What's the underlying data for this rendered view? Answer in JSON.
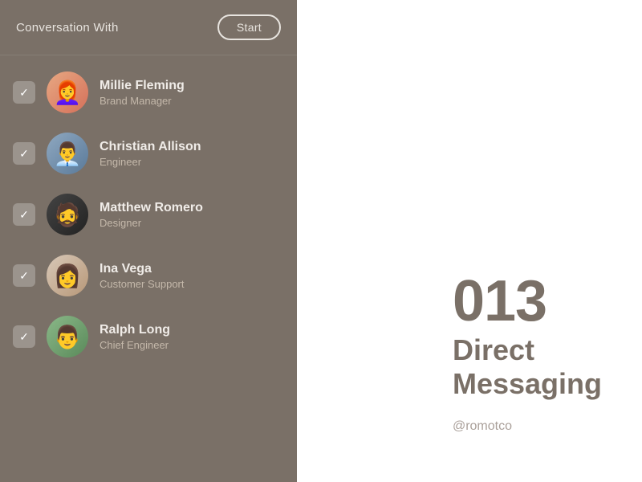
{
  "header": {
    "title": "Conversation With",
    "start_button": "Start"
  },
  "contacts": [
    {
      "id": "millie",
      "name": "Millie Fleming",
      "role": "Brand Manager",
      "checked": true,
      "emoji": "👩"
    },
    {
      "id": "christian",
      "name": "Christian Allison",
      "role": "Engineer",
      "checked": true,
      "emoji": "👨"
    },
    {
      "id": "matthew",
      "name": "Matthew Romero",
      "role": "Designer",
      "checked": true,
      "emoji": "🧔"
    },
    {
      "id": "ina",
      "name": "Ina Vega",
      "role": "Customer Support",
      "checked": true,
      "emoji": "👩"
    },
    {
      "id": "ralph",
      "name": "Ralph Long",
      "role": "Chief Engineer",
      "checked": true,
      "emoji": "👨"
    }
  ],
  "branding": {
    "number": "013",
    "title_line1": "Direct",
    "title_line2": "Messaging",
    "handle": "@romotco"
  }
}
